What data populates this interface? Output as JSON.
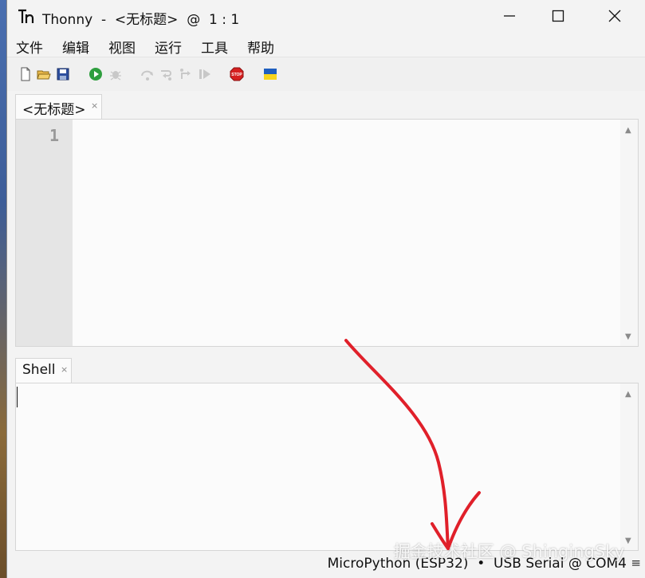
{
  "window": {
    "title": "Thonny  -  <无标题>  @  1 : 1"
  },
  "menu": [
    "文件",
    "编辑",
    "视图",
    "运行",
    "工具",
    "帮助"
  ],
  "toolbar": {
    "icons": [
      "new-file-icon",
      "open-file-icon",
      "save-icon",
      "run-icon",
      "debug-icon",
      "step-over-icon",
      "step-into-icon",
      "step-out-icon",
      "resume-icon",
      "stop-icon",
      "ukraine-flag-icon"
    ],
    "stop_label": "STOP"
  },
  "editor": {
    "tab_label": "<无标题>",
    "close_glyph": "×",
    "line_numbers": [
      "1"
    ]
  },
  "shell": {
    "tab_label": "Shell",
    "close_glyph": "×"
  },
  "status": {
    "interpreter": "MicroPython (ESP32)  •  USB Serial @ COM4",
    "menu_glyph": "≡"
  },
  "watermark": "掘金技术社区 @ ShingingSky",
  "colors": {
    "annotation_arrow": "#e0202a",
    "run_green": "#2e9e3e",
    "stop_red": "#d62020"
  }
}
